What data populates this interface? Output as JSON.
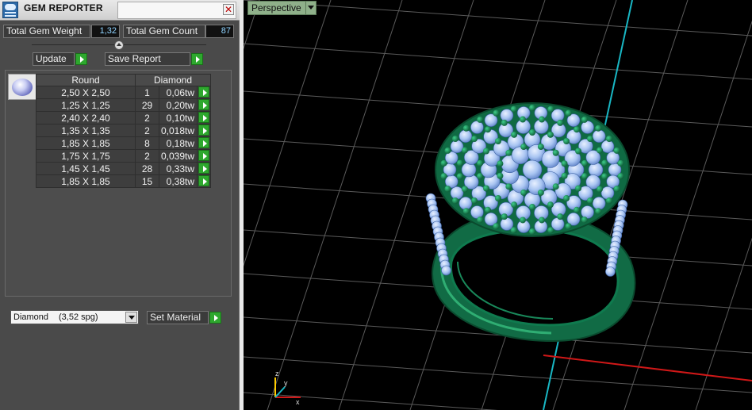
{
  "panel": {
    "title": "GEM REPORTER",
    "close_label": "✕",
    "total_weight_label": "Total Gem Weight",
    "total_weight_value": "1,32",
    "total_count_label": "Total Gem Count",
    "total_count_value": "87",
    "update_label": "Update",
    "save_report_label": "Save Report",
    "table": {
      "header_shape": "Round",
      "header_material": "Diamond",
      "rows": [
        {
          "size": "2,50 X 2,50",
          "count": "1",
          "weight": "0,06tw"
        },
        {
          "size": "1,25 X 1,25",
          "count": "29",
          "weight": "0,20tw"
        },
        {
          "size": "2,40 X 2,40",
          "count": "2",
          "weight": "0,10tw"
        },
        {
          "size": "1,35 X 1,35",
          "count": "2",
          "weight": "0,018tw"
        },
        {
          "size": "1,85 X 1,85",
          "count": "8",
          "weight": "0,18tw"
        },
        {
          "size": "1,75 X 1,75",
          "count": "2",
          "weight": "0,039tw"
        },
        {
          "size": "1,45 X 1,45",
          "count": "28",
          "weight": "0,33tw"
        },
        {
          "size": "1,85 X 1,85",
          "count": "15",
          "weight": "0,38tw"
        }
      ]
    },
    "material_select": {
      "name": "Diamond",
      "spg": "(3,52 spg)"
    },
    "set_material_label": "Set Material"
  },
  "viewport": {
    "view_name": "Perspective",
    "axis_colors": {
      "x": "#d01818",
      "y": "#19b7c4",
      "z": "#ffcc00"
    }
  }
}
